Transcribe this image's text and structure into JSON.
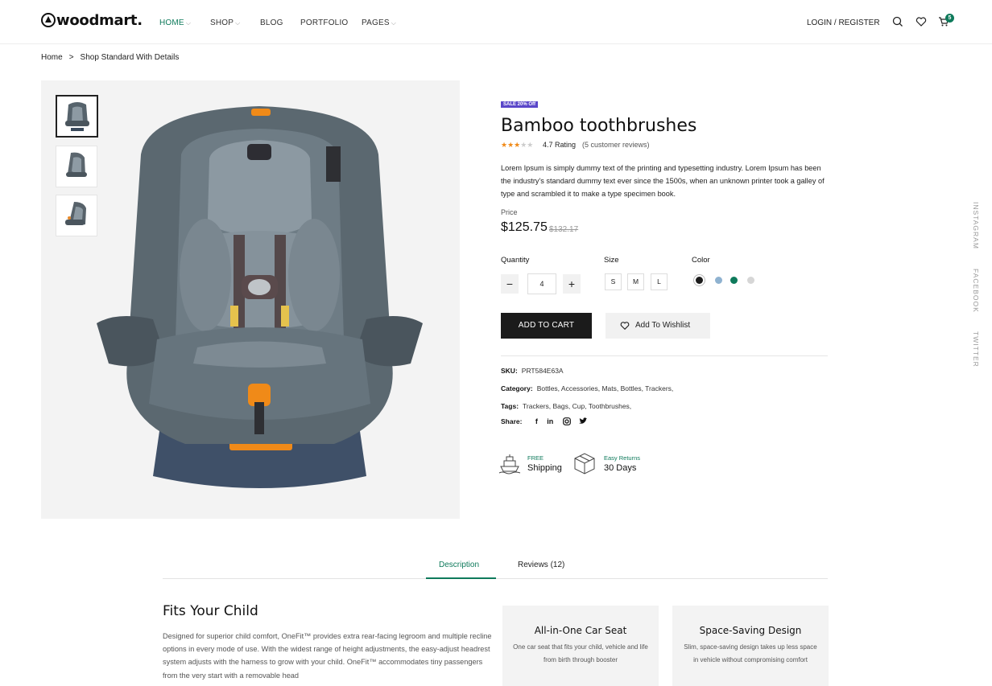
{
  "header": {
    "logo": "woodmart.",
    "nav": [
      {
        "label": "HOME",
        "has_dropdown": true,
        "active": true
      },
      {
        "label": "SHOP",
        "has_dropdown": true
      },
      {
        "label": "BLOG"
      },
      {
        "label": "PORTFOLIO"
      },
      {
        "label": "PAGES",
        "has_dropdown": true
      }
    ],
    "login": "LOGIN / REGISTER",
    "cart_count": "5",
    "icons": [
      "search-icon",
      "heart-icon",
      "cart-icon"
    ]
  },
  "breadcrumb": {
    "home": "Home",
    "separator": ">",
    "current": "Shop Standard With Details"
  },
  "product": {
    "badge": "SALE 20% Off",
    "title": "Bamboo toothbrushes",
    "stars_filled": 3,
    "stars_total": 5,
    "rating": "4.7 Rating",
    "reviews": "(5 customer reviews)",
    "description": "Lorem Ipsum is simply dummy text of the printing and typesetting industry. Lorem Ipsum has been the industry's standard dummy text ever since the 1500s, when an unknown printer took a galley of type and scrambled it to make a type specimen book.",
    "price_label": "Price",
    "price": "$125.75",
    "old_price": "$132.17",
    "quantity_label": "Quantity",
    "quantity": "4",
    "minus": "−",
    "plus": "+",
    "size_label": "Size",
    "sizes": [
      "S",
      "M",
      "L"
    ],
    "color_label": "Color",
    "colors": [
      "#1c1c1c",
      "#8fb2d0",
      "#0e7a5b",
      "#d6d6d6"
    ],
    "add_to_cart": "ADD TO CART",
    "wishlist": "Add To Wishlist",
    "sku_label": "SKU:",
    "sku": "PRT584E63A",
    "category_label": "Category:",
    "category": "Bottles,  Accessories,  Mats,  Bottles,  Trackers,",
    "tags_label": "Tags:",
    "tags": "Trackers,  Bags,  Cup,  Toothbrushes,",
    "share_label": "Share:",
    "share": [
      "f",
      "in"
    ],
    "features": [
      {
        "top": "FREE",
        "bottom": "Shipping"
      },
      {
        "top": "Easy Returns",
        "bottom": "30 Days"
      }
    ]
  },
  "side_links": [
    "INSTAGRAM",
    "FACEBOOK",
    "TWITTER"
  ],
  "tabs": [
    {
      "label": "Description",
      "active": true
    },
    {
      "label": "Reviews (12)"
    }
  ],
  "content": {
    "heading": "Fits Your Child",
    "body": "Designed for superior child comfort, OneFit™ provides extra rear-facing legroom and multiple recline options in every mode of use. With the widest range of height adjustments, the easy-adjust headrest system adjusts with the harness to grow with your child. OneFit™ accommodates tiny passengers from the very start with a removable head",
    "cards": [
      {
        "title": "All-in-One Car Seat",
        "text": "One car seat that fits your child, vehicle and life from birth through booster"
      },
      {
        "title": "Space-Saving Design",
        "text": "Slim, space-saving design takes up less space in vehicle without compromising comfort"
      }
    ]
  },
  "colors": {
    "accent": "#0e7a5b",
    "badge": "#5a47c9",
    "dark_button": "#1b1b1b",
    "star": "#f08a18"
  }
}
